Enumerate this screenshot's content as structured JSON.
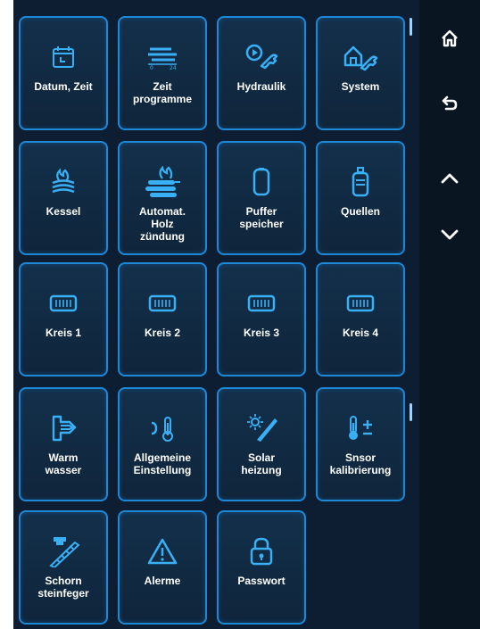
{
  "tiles": [
    {
      "id": "datum-zeit",
      "label": "Datum, Zeit",
      "icon": "calendar-icon"
    },
    {
      "id": "zeitprogramme",
      "label": "Zeit\nprogramme",
      "icon": "schedule-icon"
    },
    {
      "id": "hydraulik",
      "label": "Hydraulik",
      "icon": "pump-wrench-icon"
    },
    {
      "id": "system",
      "label": "System",
      "icon": "house-wrench-icon"
    },
    {
      "id": "kessel",
      "label": "Kessel",
      "icon": "boiler-flame-icon"
    },
    {
      "id": "automat-holz",
      "label": "Automat.\nHolz\nzündung",
      "icon": "wood-ignition-icon"
    },
    {
      "id": "pufferspeicher",
      "label": "Puffer\nspeicher",
      "icon": "buffer-tank-icon"
    },
    {
      "id": "quellen",
      "label": "Quellen",
      "icon": "gas-canister-icon"
    },
    {
      "id": "kreis-1",
      "label": "Kreis 1",
      "icon": "radiator-icon"
    },
    {
      "id": "kreis-2",
      "label": "Kreis 2",
      "icon": "radiator-icon"
    },
    {
      "id": "kreis-3",
      "label": "Kreis 3",
      "icon": "radiator-icon"
    },
    {
      "id": "kreis-4",
      "label": "Kreis 4",
      "icon": "radiator-icon"
    },
    {
      "id": "warmwasser",
      "label": "Warm\nwasser",
      "icon": "faucet-icon"
    },
    {
      "id": "allgemeine",
      "label": "Allgemeine\nEinstellung",
      "icon": "moon-thermometer-icon"
    },
    {
      "id": "solarheizung",
      "label": "Solar\nheizung",
      "icon": "solar-panel-icon"
    },
    {
      "id": "snsor",
      "label": "Snsor\nkalibrierung",
      "icon": "thermometer-plusminus-icon"
    },
    {
      "id": "schornsteinfeger",
      "label": "Schorn\nsteinfeger",
      "icon": "chimney-ladder-icon"
    },
    {
      "id": "alarme",
      "label": "Alerme",
      "icon": "warning-icon"
    },
    {
      "id": "passwort",
      "label": "Passwort",
      "icon": "lock-icon"
    }
  ],
  "sidebar": {
    "home_icon": "home-icon",
    "back_icon": "back-icon",
    "up_icon": "chevron-up-icon",
    "down_icon": "chevron-down-icon"
  },
  "colors": {
    "accent": "#1e88d8",
    "icon": "#39b0f5",
    "background": "#0d1e32"
  }
}
